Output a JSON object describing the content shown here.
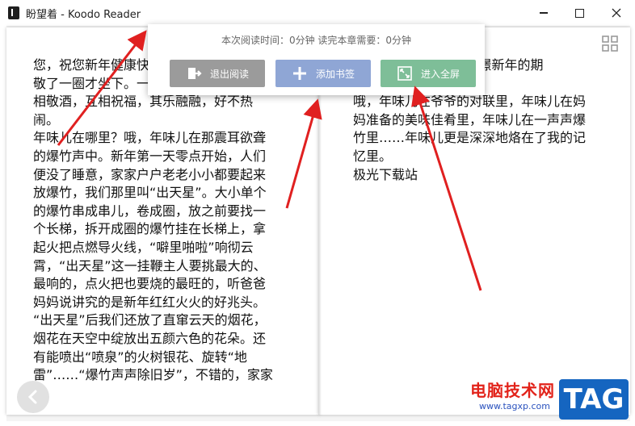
{
  "window": {
    "title": "盼望着 - Koodo Reader"
  },
  "status": {
    "text": "本次阅读时间：0分钟   读完本章需要：0分钟"
  },
  "actions": {
    "exit_label": "退出阅读",
    "bookmark_label": "添加书签",
    "fullscreen_label": "进入全屏"
  },
  "left_page": {
    "lines": [
      "您，祝您新年健康快乐，",
      "敬了一圈才坐下。一",
      "相敬酒，互相祝福，其乐融融，好不热",
      "闹。",
      "年味儿在哪里？哦，年味儿在那震耳欲聋",
      "的爆竹声中。新年第一天零点开始，人们",
      "便没了睡意，家家户户老老小小都要起来",
      "放爆竹，我们那里叫“出天星”。大小单个",
      "的爆竹串成串儿，卷成圈，放之前要找一",
      "个长梯，拆开成圈的爆竹挂在长梯上，拿",
      "起火把点燃导火线，“噼里啪啦”响彻云",
      "霄，“出天星”这一挂鞭主人要挑最大的、",
      "最响的，点火把也要烧的最旺的，听爸爸",
      "妈妈说讲究的是新年红红火火的好兆头。",
      "“出天星”后我们还放了直窜云天的烟花，",
      "烟花在天空中绽放出五颜六色的花朵。还",
      "有能喷出“喷泉”的火树银花、旋转“地",
      "雷”……“爆竹声声除旧岁”，不错的，家家"
    ]
  },
  "right_page": {
    "lines": [
      "                  爆竹来憧憬新年的期",
      "",
      "哦，年味儿在爷爷的对联里，年味儿在妈",
      "妈准备的美味佳肴里，年味儿在一声声爆",
      "竹里……年味儿更是深深地烙在了我的记",
      "忆里。",
      "极光下载站"
    ]
  },
  "watermark": {
    "site_name": "电脑技术网",
    "url": "www.tagxp.com",
    "badge": "TAG"
  },
  "colors": {
    "exit": "#9b9b9b",
    "bookmark": "#8fa6d5",
    "fullscreen": "#7ebe98",
    "arrow": "#e02020"
  }
}
